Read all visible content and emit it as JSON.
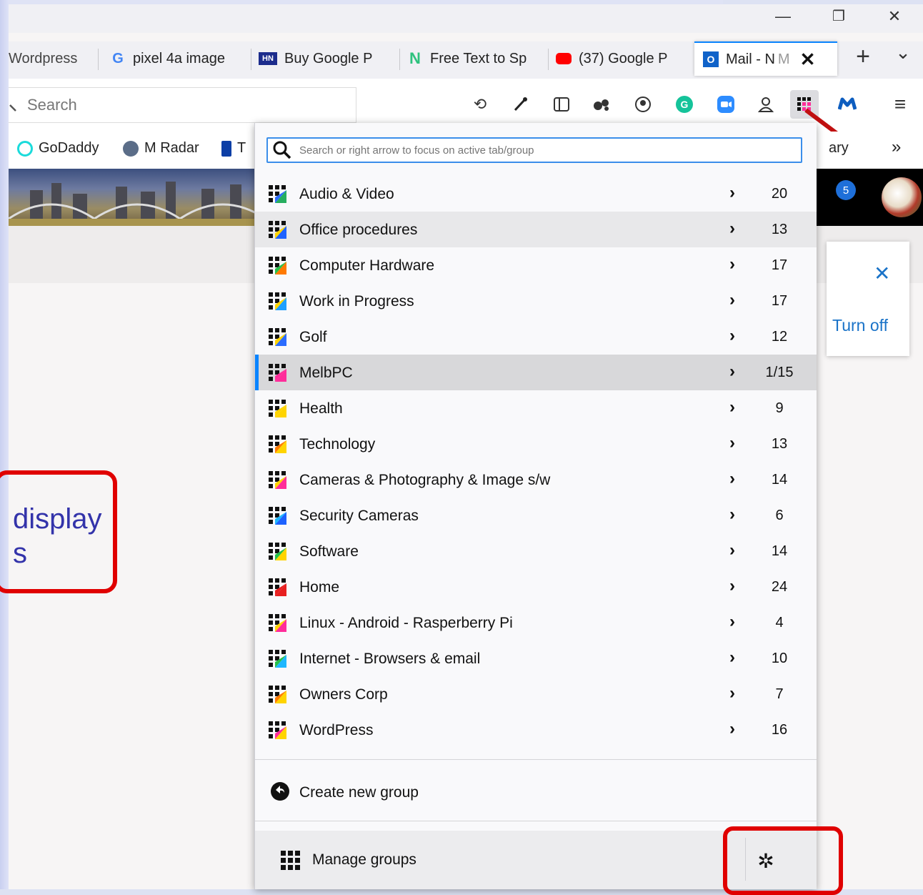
{
  "window": {
    "minimize_glyph": "—",
    "restore_glyph": "❐",
    "close_glyph": "✕"
  },
  "tabs": [
    {
      "title": "Wordpress",
      "icon": "wordpress-tab-icon"
    },
    {
      "title": "pixel 4a image",
      "icon_text": "G"
    },
    {
      "title": "Buy Google P",
      "icon_text": "HN"
    },
    {
      "title": "Free Text to Sp",
      "icon_text": "N"
    },
    {
      "title": "(37) Google P",
      "icon": "youtube-icon"
    },
    {
      "title": "Mail - N",
      "title_fade": "M",
      "icon_text": "O",
      "close": "✕"
    }
  ],
  "tab_actions": {
    "new_tab": "+",
    "list_all": "⌄"
  },
  "urlbar": {
    "placeholder": "Search"
  },
  "toolbar_icons": [
    "history-icon",
    "eyedropper-icon",
    "sidebar-icon",
    "extensions-icon",
    "account-icon",
    "grammarly-icon",
    "zoom-icon",
    "person-icon",
    "simple-tab-groups-icon",
    "malwarebytes-icon",
    "menu-icon"
  ],
  "bookmarks": [
    {
      "label": "GoDaddy"
    },
    {
      "label": "M Radar"
    },
    {
      "label": "T"
    }
  ],
  "bookmarks_overflow": {
    "partial_label": "ary",
    "chevron": "»"
  },
  "notification": {
    "close": "✕",
    "action": "Turn off",
    "badge": "5"
  },
  "callout": {
    "line1": "display",
    "line2": "s"
  },
  "panel": {
    "search_placeholder": "Search or right arrow to focus on active tab/group",
    "chevron": "›",
    "groups": [
      {
        "name": "Audio & Video",
        "count": "20",
        "c1": "#27ae60",
        "c2": "#2b6cff"
      },
      {
        "name": "Office procedures",
        "count": "13",
        "c1": "#1e62ff",
        "c2": "#ffd400"
      },
      {
        "name": "Computer Hardware",
        "count": "17",
        "c1": "#ff7a00",
        "c2": "#27c04a"
      },
      {
        "name": "Work in Progress",
        "count": "17",
        "c1": "#1e9fff",
        "c2": "#ffd400"
      },
      {
        "name": "Golf",
        "count": "12",
        "c1": "#2b6cff",
        "c2": "#ffd400"
      },
      {
        "name": "MelbPC",
        "count": "1/15",
        "c1": "#ff2d9a",
        "c2": "#ff2d9a"
      },
      {
        "name": "Health",
        "count": "9",
        "c1": "#ffd400",
        "c2": "#ffd400"
      },
      {
        "name": "Technology",
        "count": "13",
        "c1": "#ffd400",
        "c2": "#ff7a00"
      },
      {
        "name": "Cameras & Photography & Image s/w",
        "count": "14",
        "c1": "#ff2d9a",
        "c2": "#ffd400"
      },
      {
        "name": "Security Cameras",
        "count": "6",
        "c1": "#1e62ff",
        "c2": "#1eb7ff"
      },
      {
        "name": "Software",
        "count": "14",
        "c1": "#ffd400",
        "c2": "#27c04a"
      },
      {
        "name": "Home",
        "count": "24",
        "c1": "#e82020",
        "c2": "#e82020"
      },
      {
        "name": "Linux - Android - Rasperberry Pi",
        "count": "4",
        "c1": "#ff2d9a",
        "c2": "#ffd400"
      },
      {
        "name": "Internet - Browsers & email",
        "count": "10",
        "c1": "#1eb7ff",
        "c2": "#27c04a"
      },
      {
        "name": "Owners Corp",
        "count": "7",
        "c1": "#ffd400",
        "c2": "#ff7a00"
      },
      {
        "name": "WordPress",
        "count": "16",
        "c1": "#ffd400",
        "c2": "#ff2d9a"
      }
    ],
    "hover_index": 1,
    "active_index": 5,
    "create_label": "Create new group",
    "manage_label": "Manage groups",
    "settings_glyph": "✲"
  },
  "colors": {
    "accent": "#0a84ff",
    "highlight_red": "#e00000",
    "turn_off": "#1a73c8"
  }
}
